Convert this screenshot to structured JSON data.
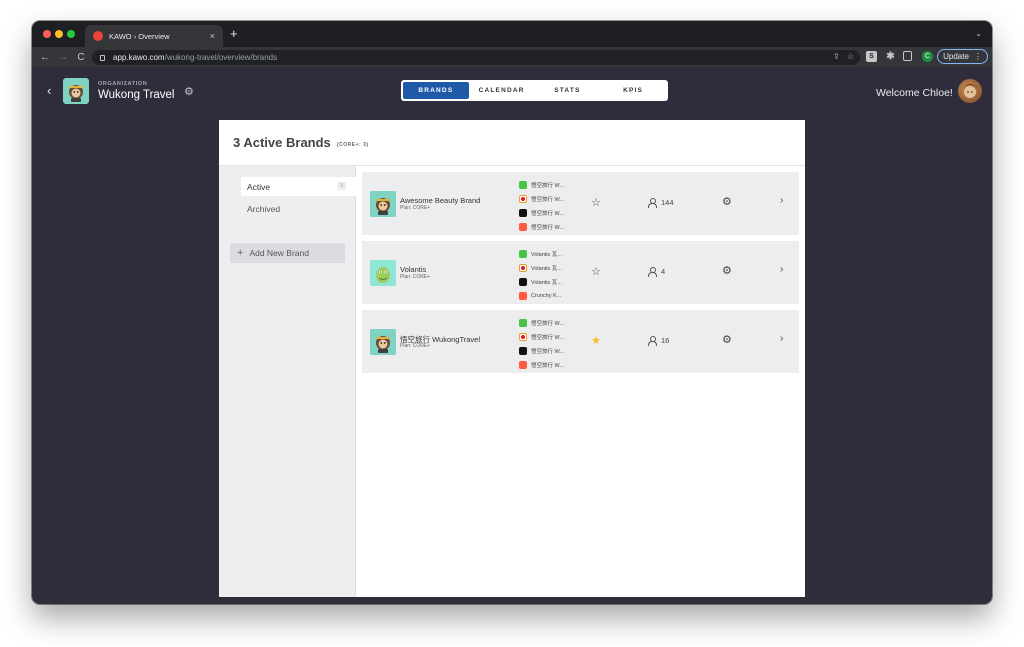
{
  "browser": {
    "tab_title": "KAWO › Overview",
    "tab_close": "×",
    "new_tab": "+",
    "tab_menu": "⌄",
    "url_host": "app.kawo.com",
    "url_path": "/wukong-travel/overview/brands",
    "profile_initial": "C",
    "update_label": "Update",
    "update_menu": "⋮",
    "back": "←",
    "forward": "→",
    "reload": "C",
    "share_icon": "⇪",
    "bookmark_icon": "☆",
    "ext_s": "S",
    "ext_puzzle": "✱"
  },
  "org": {
    "back_chevron": "‹",
    "label": "ORGANIZATION",
    "name": "Wukong Travel",
    "gear": "⚙"
  },
  "nav_tabs": [
    {
      "label": "BRANDS",
      "active": true
    },
    {
      "label": "CALENDAR",
      "active": false
    },
    {
      "label": "STATS",
      "active": false
    },
    {
      "label": "KPIS",
      "active": false
    }
  ],
  "user": {
    "welcome": "Welcome Chloe!"
  },
  "panel": {
    "title": "3 Active Brands",
    "subtitle": "(CORE+: 3)"
  },
  "sidebar": {
    "active_label": "Active",
    "active_count": "3",
    "archived_label": "Archived",
    "add_plus": "+",
    "add_label": "Add New Brand"
  },
  "brands": [
    {
      "name": "Awesome Beauty Brand",
      "plan": "Plan: CORE+",
      "channels": [
        "悟空旅行 W...",
        "悟空旅行 W...",
        "悟空旅行 W...",
        "悟空旅行 W..."
      ],
      "favorite": false,
      "star": "☆",
      "members": "144",
      "gear": "⚙",
      "chevron": "›",
      "logo": "monkey"
    },
    {
      "name": "Volantis",
      "plan": "Plan: CORE+",
      "channels": [
        "Volantis 瓦...",
        "Volantis 瓦...",
        "Volantis 瓦...",
        "Crunchy K..."
      ],
      "favorite": false,
      "star": "☆",
      "members": "4",
      "gear": "⚙",
      "chevron": "›",
      "logo": "creature"
    },
    {
      "name": "悟空旅行 WukongTravel",
      "plan": "Plan: CORE+",
      "channels": [
        "悟空旅行 W...",
        "悟空旅行 W...",
        "悟空旅行 W...",
        "悟空旅行 W..."
      ],
      "favorite": true,
      "star": "★",
      "members": "16",
      "gear": "⚙",
      "chevron": "›",
      "logo": "monkey"
    }
  ],
  "colors": {
    "window_bg": "#2f2d3b",
    "active_tab": "#1f5aa8",
    "favorite_star": "#f2c21c",
    "row_bg": "#ededef"
  }
}
